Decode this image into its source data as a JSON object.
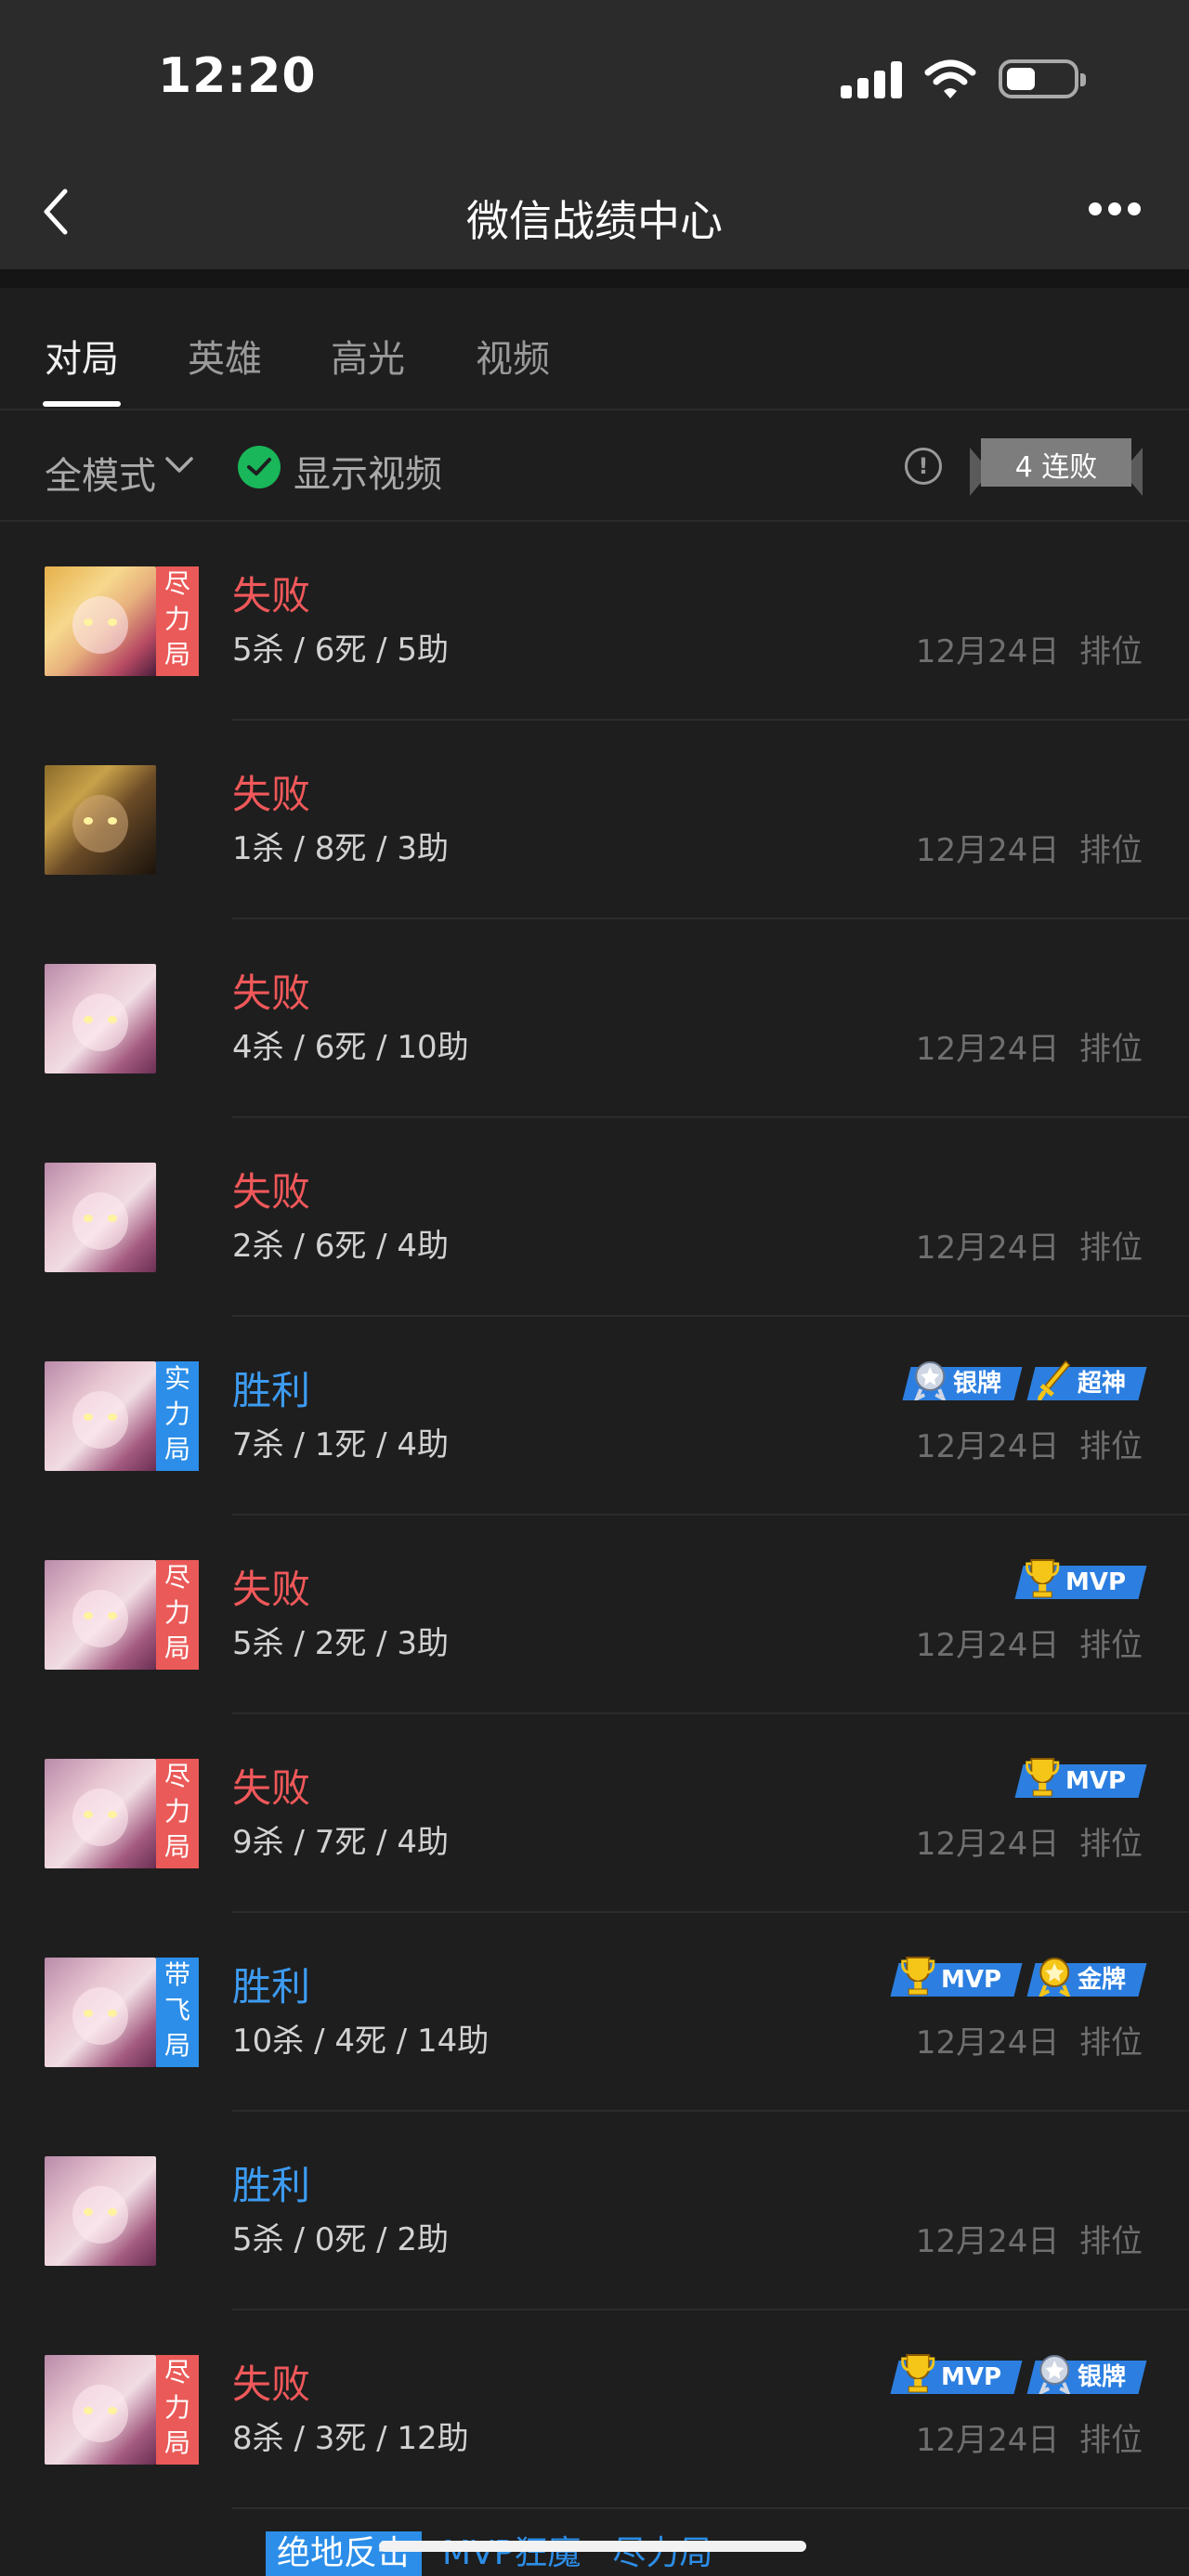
{
  "status_bar": {
    "time": "12:20"
  },
  "nav": {
    "title": "微信战绩中心"
  },
  "tabs": [
    {
      "label": "对局",
      "active": true
    },
    {
      "label": "英雄",
      "active": false
    },
    {
      "label": "高光",
      "active": false
    },
    {
      "label": "视频",
      "active": false
    }
  ],
  "filter": {
    "mode": "全模式",
    "show_video": "显示视频",
    "streak": "4 连败"
  },
  "matches": [
    {
      "result": "失败",
      "kda": "5杀 / 6死 / 5助",
      "date": "12月24日",
      "mode": "排位",
      "tag": "尽力局",
      "tag_color": "red",
      "avatar": "girl2",
      "badges": []
    },
    {
      "result": "失败",
      "kda": "1杀 / 8死 / 3助",
      "date": "12月24日",
      "mode": "排位",
      "tag": "",
      "avatar": "man",
      "badges": []
    },
    {
      "result": "失败",
      "kda": "4杀 / 6死 / 10助",
      "date": "12月24日",
      "mode": "排位",
      "tag": "",
      "avatar": "girl",
      "badges": []
    },
    {
      "result": "失败",
      "kda": "2杀 / 6死 / 4助",
      "date": "12月24日",
      "mode": "排位",
      "tag": "",
      "avatar": "girl",
      "badges": []
    },
    {
      "result": "胜利",
      "kda": "7杀 / 1死 / 4助",
      "date": "12月24日",
      "mode": "排位",
      "tag": "实力局",
      "tag_color": "blue",
      "avatar": "girl",
      "badges": [
        {
          "label": "银牌",
          "icon": "silver-medal-icon"
        },
        {
          "label": "超神",
          "icon": "sword-icon"
        }
      ]
    },
    {
      "result": "失败",
      "kda": "5杀 / 2死 / 3助",
      "date": "12月24日",
      "mode": "排位",
      "tag": "尽力局",
      "tag_color": "red",
      "avatar": "girl",
      "badges": [
        {
          "label": "MVP",
          "icon": "trophy-icon"
        }
      ]
    },
    {
      "result": "失败",
      "kda": "9杀 / 7死 / 4助",
      "date": "12月24日",
      "mode": "排位",
      "tag": "尽力局",
      "tag_color": "red",
      "avatar": "girl",
      "badges": [
        {
          "label": "MVP",
          "icon": "trophy-icon"
        }
      ]
    },
    {
      "result": "胜利",
      "kda": "10杀 / 4死 / 14助",
      "date": "12月24日",
      "mode": "排位",
      "tag": "带飞局",
      "tag_color": "blue",
      "avatar": "girl",
      "badges": [
        {
          "label": "MVP",
          "icon": "trophy-icon"
        },
        {
          "label": "金牌",
          "icon": "gold-medal-icon"
        }
      ]
    },
    {
      "result": "胜利",
      "kda": "5杀 / 0死 / 2助",
      "date": "12月24日",
      "mode": "排位",
      "tag": "",
      "avatar": "girl",
      "badges": []
    },
    {
      "result": "失败",
      "kda": "8杀 / 3死 / 12助",
      "date": "12月24日",
      "mode": "排位",
      "tag": "尽力局",
      "tag_color": "red",
      "avatar": "girl",
      "badges": [
        {
          "label": "MVP",
          "icon": "trophy-icon"
        },
        {
          "label": "银牌",
          "icon": "silver-medal-icon"
        }
      ]
    }
  ],
  "bottom_peek": [
    "绝地反击",
    "MVP狂魔",
    "尽力局"
  ],
  "colors": {
    "lose": "#f0585a",
    "win": "#3d9bf0",
    "badge_blue": "#2c7fe0",
    "tag_red": "#ea5a58",
    "tag_blue": "#2c8ee8"
  }
}
